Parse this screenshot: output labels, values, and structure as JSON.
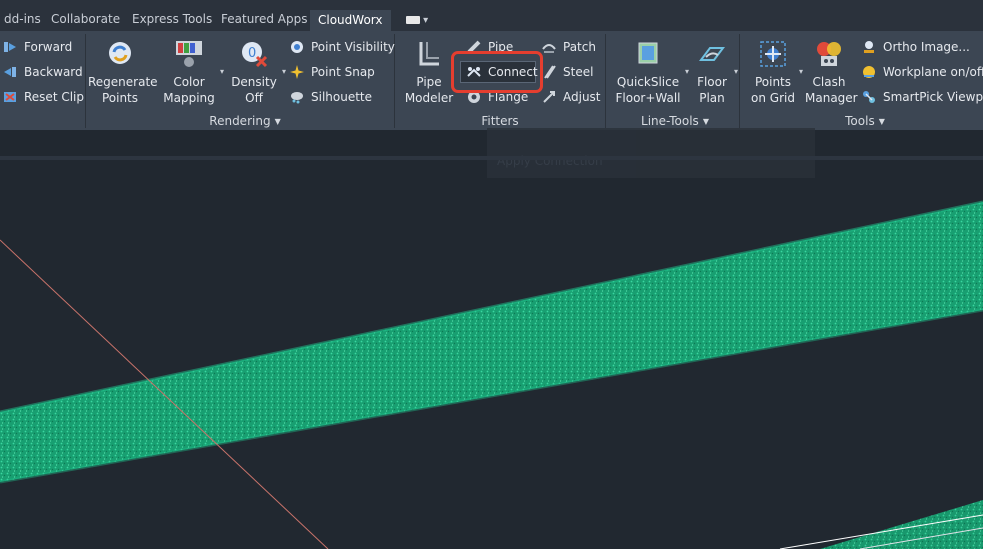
{
  "tabs": [
    "dd-ins",
    "Collaborate",
    "Express Tools",
    "Featured Apps",
    "CloudWorx"
  ],
  "active_tab": "CloudWorx",
  "panels": {
    "rendering": "Rendering",
    "fitters": "Fitters",
    "line_tools": "Line-Tools",
    "tools": "Tools"
  },
  "clip_buttons": [
    "Forward",
    "Backward",
    "Reset Clip"
  ],
  "regenerate": [
    "Regenerate",
    "Points"
  ],
  "color_mapping": [
    "Color",
    "Mapping"
  ],
  "density": [
    "Density",
    "Off"
  ],
  "visibility_buttons": [
    "Point Visibility",
    "Point Snap",
    "Silhouette"
  ],
  "pipe_modeler": [
    "Pipe",
    "Modeler"
  ],
  "fitters_left": [
    "Pipe",
    "Connect",
    "Flange"
  ],
  "fitters_right": [
    "Patch",
    "Steel",
    "Adjust"
  ],
  "quickslice": [
    "QuickSlice",
    "Floor+Wall"
  ],
  "floor_plan": [
    "Floor",
    "Plan"
  ],
  "points_on_grid": [
    "Points",
    "on Grid"
  ],
  "clash_manager": [
    "Clash",
    "Manager"
  ],
  "tools_buttons": [
    "Ortho Image...",
    "Workplane on/off",
    "SmartPick Viewport"
  ],
  "tooltip_text": "Apply Connection",
  "colors": {
    "ribbon": "#3c4653",
    "viewport": "#212830",
    "point_cloud": "#1fbf8a",
    "highlight": "#e53e2f"
  }
}
